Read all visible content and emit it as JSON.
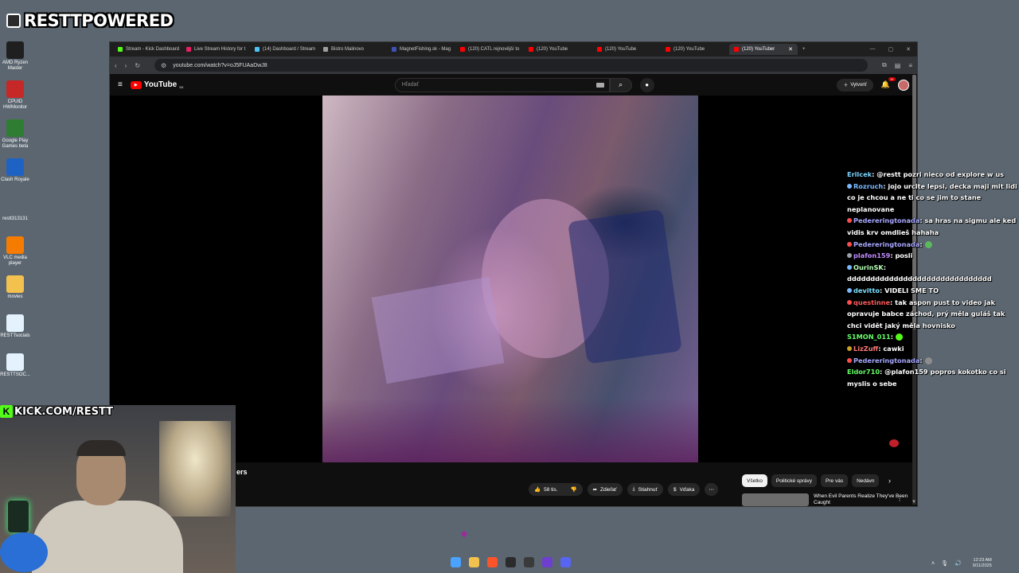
{
  "overlay": {
    "brand": "RESTTPOWERED",
    "kick_url": "KICK.COM/RESTT"
  },
  "desktop": {
    "icons": [
      {
        "label": "AMD Ryzen Master",
        "icon": "amd-ryzen-icon",
        "color": "#1f1f1f"
      },
      {
        "label": "CPUID HWMonitor",
        "icon": "hwmonitor-icon",
        "color": "#c62828"
      },
      {
        "label": "Google Play Games beta",
        "icon": "google-play-games-icon",
        "color": "#2e7d32"
      },
      {
        "label": "Clash Royale",
        "icon": "clash-royale-icon",
        "color": "#1e63c4"
      },
      {
        "label": "restt313131",
        "icon": "blank-file-icon",
        "color": "#5b6670"
      },
      {
        "label": "VLC media player",
        "icon": "vlc-icon",
        "color": "#f57c00"
      },
      {
        "label": "movies",
        "icon": "folder-icon",
        "color": "#f2c14e"
      },
      {
        "label": "RESTTsocials",
        "icon": "document-icon",
        "color": "#e3f2fd"
      },
      {
        "label": "RESTTSOC...",
        "icon": "document-icon",
        "color": "#e3f2fd"
      }
    ]
  },
  "browser": {
    "tabs": [
      {
        "label": "Stream - Kick Dashboard",
        "color": "#53fc18",
        "active": false
      },
      {
        "label": "Live Stream History for t",
        "color": "#e91e63",
        "active": false
      },
      {
        "label": "(14) Dashboard / Stream",
        "color": "#4fc3f7",
        "active": false
      },
      {
        "label": "Bistro Malinovo",
        "color": "#9e9e9e",
        "active": false
      },
      {
        "label": "MagnetFishing.sk - Mag",
        "color": "#3f51b5",
        "active": false
      },
      {
        "label": "(120) CATL rejnovější to",
        "color": "#ff0000",
        "active": false
      },
      {
        "label": "(120) YouTube",
        "color": "#ff0000",
        "active": false
      },
      {
        "label": "(120) YouTube",
        "color": "#ff0000",
        "active": false
      },
      {
        "label": "(120) YouTube",
        "color": "#ff0000",
        "active": false
      },
      {
        "label": "(120) YouTuber",
        "color": "#ff0000",
        "active": true
      }
    ],
    "url": "youtube.com/watch?v=oJ5FUAaDwJ8"
  },
  "youtube": {
    "logo_text": "YouTube",
    "region": "SK",
    "search_placeholder": "Hľadať",
    "create_label": "Vytvoriť",
    "notif_count": "9+",
    "title_fragment": "ers",
    "actions": {
      "likes": "58 tis.",
      "share": "Zdieľať",
      "download": "Stiahnuť",
      "thanks": "Vďaka"
    },
    "chips": [
      "Všetko",
      "Politické správy",
      "Pre vás",
      "Nedávn"
    ],
    "reco_title": "When Evil Parents Realize They've Been Caught"
  },
  "chat": [
    {
      "user": "Erilcek",
      "color": "#7cd3ff",
      "text": "@restt pozri nieco od explore w us",
      "dot": ""
    },
    {
      "user": "Rozruch",
      "color": "#7ab8ff",
      "text": "jojo urcite lepsi, decka maji mit lidi co je chcou a ne ti co se jim to stane neplanovane",
      "dot": "#7ab8ff"
    },
    {
      "user": "Pedereringtonada",
      "color": "#a7a7ff",
      "text": "sa hras na sigmu ale ked vidis krv omdlieš hahaha",
      "dot": "#ff4c4c"
    },
    {
      "user": "Pedereringtonada",
      "color": "#a7a7ff",
      "text": "",
      "dot": "#ff4c4c",
      "emoji": "#5cb85c"
    },
    {
      "user": "plafon159",
      "color": "#c18bff",
      "text": "posli",
      "dot": "#9aa0a6"
    },
    {
      "user": "OurinSK",
      "color": "#b5ffb5",
      "text": "ddddddddddddddddddddddddddddddd",
      "dot": "#7ab8ff"
    },
    {
      "user": "devitto",
      "color": "#7ee0ff",
      "text": "VIDELI SME TO",
      "dot": "#7ab8ff"
    },
    {
      "user": "questinne",
      "color": "#ff5a5a",
      "text": "tak aspon pust to video jak opravuje babce záchod, prý měla guláš tak chci vidět jaký měla hovnisko",
      "dot": "#ff4c4c"
    },
    {
      "user": "S1MON_011",
      "color": "#66ff66",
      "text": "",
      "dot": "",
      "emoji": "#53fc18"
    },
    {
      "user": "LizZuff",
      "color": "#ff7a7a",
      "text": "cawki",
      "dot": "#c9a227"
    },
    {
      "user": "Pedereringtonada",
      "color": "#a7a7ff",
      "text": "",
      "dot": "#ff4c4c",
      "emoji": "#8d8d8d"
    },
    {
      "user": "Eldor710",
      "color": "#66ff66",
      "text": "@plafon159 popros kokotko co si myslis o sebe",
      "dot": ""
    }
  ],
  "taskbar": {
    "apps": [
      {
        "icon": "windows-start-icon",
        "color": "#4aa3ff"
      },
      {
        "icon": "file-explorer-icon",
        "color": "#f2c14e"
      },
      {
        "icon": "brave-browser-icon",
        "color": "#fb542b"
      },
      {
        "icon": "terminal-icon",
        "color": "#2b2b2b"
      },
      {
        "icon": "obs-icon",
        "color": "#3a3a3a"
      },
      {
        "icon": "app-purple-icon",
        "color": "#6e3fcf"
      },
      {
        "icon": "discord-icon",
        "color": "#5865f2"
      }
    ],
    "time": "12:23 AM",
    "date": "9/11/2025"
  }
}
